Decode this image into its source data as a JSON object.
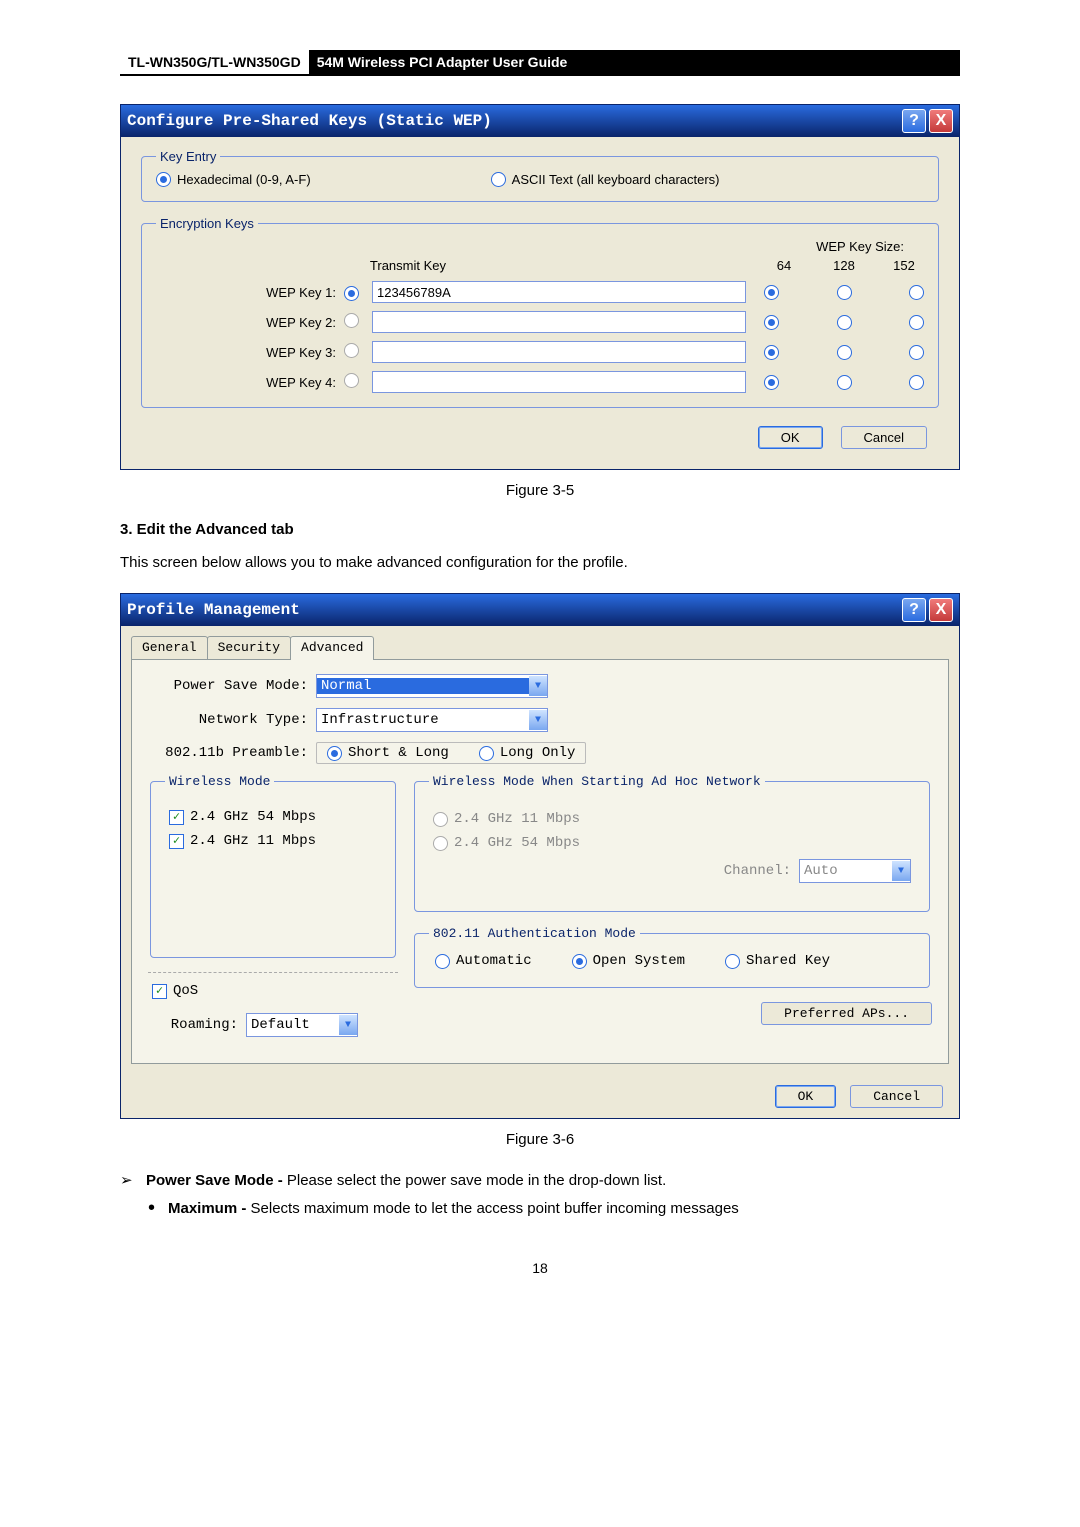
{
  "header": {
    "left": "TL-WN350G/TL-WN350GD",
    "right": "54M  Wireless  PCI  Adapter  User  Guide"
  },
  "dlg1": {
    "title": "Configure Pre-Shared Keys (Static WEP)",
    "help": "?",
    "close": "X",
    "keyEntry": {
      "legend": "Key Entry",
      "hex": "Hexadecimal (0-9, A-F)",
      "ascii": "ASCII Text (all keyboard characters)"
    },
    "enc": {
      "legend": "Encryption Keys",
      "transmit": "Transmit Key",
      "wepSize": "WEP Key Size:",
      "sizes": [
        "64",
        "128",
        "152"
      ],
      "rows": [
        {
          "label": "WEP Key 1:",
          "value": "123456789A"
        },
        {
          "label": "WEP Key 2:",
          "value": ""
        },
        {
          "label": "WEP Key 3:",
          "value": ""
        },
        {
          "label": "WEP Key 4:",
          "value": ""
        }
      ]
    },
    "ok": "OK",
    "cancel": "Cancel"
  },
  "fig1": "Figure 3-5",
  "sect3": {
    "title": "3.    Edit the Advanced tab",
    "para": "This screen below allows you to make advanced configuration for the profile."
  },
  "dlg2": {
    "title": "Profile Management",
    "help": "?",
    "close": "X",
    "tabs": [
      "General",
      "Security",
      "Advanced"
    ],
    "psm": {
      "label": "Power Save Mode:",
      "value": "Normal"
    },
    "nt": {
      "label": "Network Type:",
      "value": "Infrastructure"
    },
    "preamble": {
      "label": "802.11b Preamble:",
      "short": "Short & Long",
      "long": "Long Only"
    },
    "wm": {
      "legend": "Wireless Mode",
      "o1": "2.4 GHz 54 Mbps",
      "o2": "2.4 GHz 11 Mbps"
    },
    "adhoc": {
      "legend": "Wireless Mode When Starting Ad Hoc Network",
      "o1": "2.4 GHz 11 Mbps",
      "o2": "2.4 GHz 54 Mbps",
      "channelLabel": "Channel:",
      "channelValue": "Auto"
    },
    "auth": {
      "legend": "802.11 Authentication Mode",
      "auto": "Automatic",
      "open": "Open System",
      "shared": "Shared Key"
    },
    "qos": "QoS",
    "roaming": {
      "label": "Roaming:",
      "value": "Default"
    },
    "prefAps": "Preferred APs...",
    "ok": "OK",
    "cancel": "Cancel"
  },
  "fig2": "Figure 3-6",
  "bullets": {
    "psm": {
      "bold": "Power Save Mode - ",
      "rest": "Please select the power save mode in the drop-down list."
    },
    "max": {
      "bold": "Maximum - ",
      "rest": "Selects maximum mode to let the access point buffer incoming messages"
    }
  },
  "pageNum": "18"
}
